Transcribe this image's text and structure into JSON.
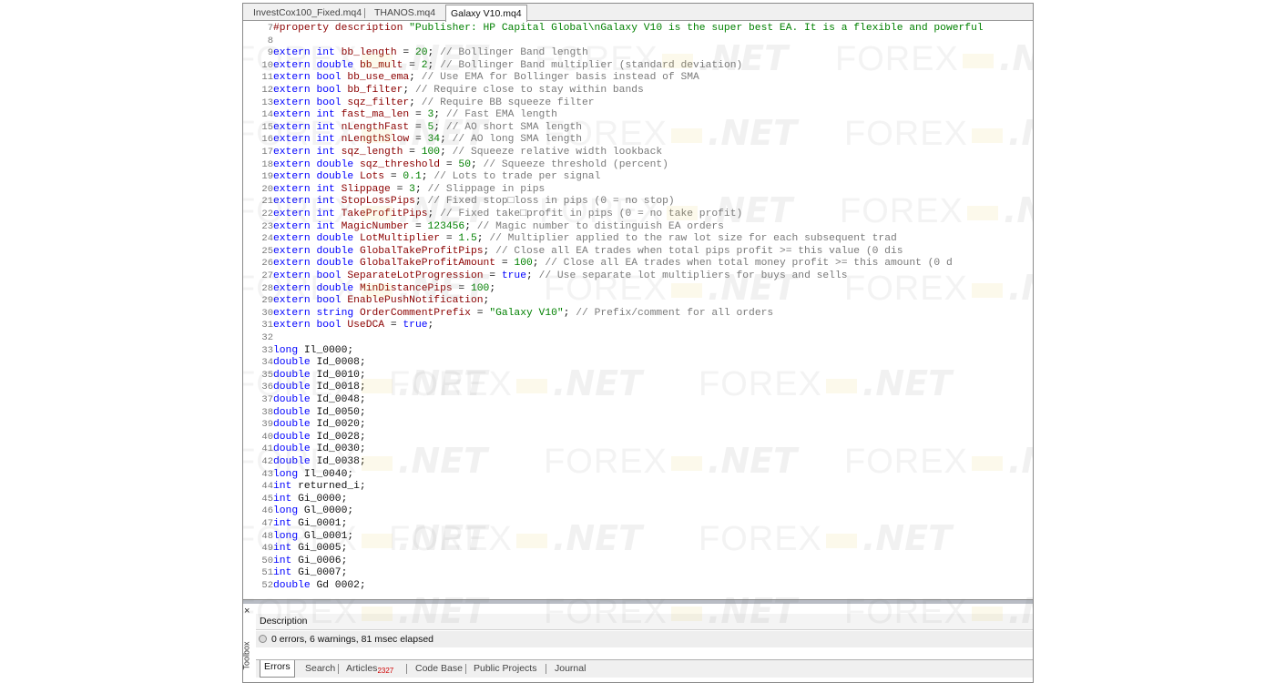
{
  "editor_tabs": [
    {
      "label": "InvestCox100_Fixed.mq4",
      "active": false
    },
    {
      "label": "THANOS.mq4",
      "active": false
    },
    {
      "label": "Galaxy V10.mq4",
      "active": true
    }
  ],
  "code_lines": [
    {
      "n": "7",
      "tokens": [
        [
          "pp",
          "#property"
        ],
        [
          "src",
          " "
        ],
        [
          "var",
          "description"
        ],
        [
          "src",
          " "
        ],
        [
          "str",
          "\"Publisher: HP Capital Global\\nGalaxy V10 is the super best EA. It is a flexible and powerful"
        ]
      ]
    },
    {
      "n": "8",
      "tokens": []
    },
    {
      "n": "9",
      "tokens": [
        [
          "kw",
          "extern"
        ],
        [
          "src",
          " "
        ],
        [
          "kw",
          "int"
        ],
        [
          "src",
          " "
        ],
        [
          "var",
          "bb_length"
        ],
        [
          "src",
          " = "
        ],
        [
          "num",
          "20"
        ],
        [
          "src",
          "; "
        ],
        [
          "cm",
          "// Bollinger Band length"
        ]
      ]
    },
    {
      "n": "10",
      "tokens": [
        [
          "kw",
          "extern"
        ],
        [
          "src",
          " "
        ],
        [
          "kw",
          "double"
        ],
        [
          "src",
          " "
        ],
        [
          "var",
          "bb_mult"
        ],
        [
          "src",
          " = "
        ],
        [
          "num",
          "2"
        ],
        [
          "src",
          "; "
        ],
        [
          "cm",
          "// Bollinger Band multiplier (standard deviation)"
        ]
      ]
    },
    {
      "n": "11",
      "tokens": [
        [
          "kw",
          "extern"
        ],
        [
          "src",
          " "
        ],
        [
          "kw",
          "bool"
        ],
        [
          "src",
          " "
        ],
        [
          "var",
          "bb_use_ema"
        ],
        [
          "src",
          "; "
        ],
        [
          "cm",
          "// Use EMA for Bollinger basis instead of SMA"
        ]
      ]
    },
    {
      "n": "12",
      "tokens": [
        [
          "kw",
          "extern"
        ],
        [
          "src",
          " "
        ],
        [
          "kw",
          "bool"
        ],
        [
          "src",
          " "
        ],
        [
          "var",
          "bb_filter"
        ],
        [
          "src",
          "; "
        ],
        [
          "cm",
          "// Require close to stay within bands"
        ]
      ]
    },
    {
      "n": "13",
      "tokens": [
        [
          "kw",
          "extern"
        ],
        [
          "src",
          " "
        ],
        [
          "kw",
          "bool"
        ],
        [
          "src",
          " "
        ],
        [
          "var",
          "sqz_filter"
        ],
        [
          "src",
          "; "
        ],
        [
          "cm",
          "// Require BB squeeze filter"
        ]
      ]
    },
    {
      "n": "14",
      "tokens": [
        [
          "kw",
          "extern"
        ],
        [
          "src",
          " "
        ],
        [
          "kw",
          "int"
        ],
        [
          "src",
          " "
        ],
        [
          "var",
          "fast_ma_len"
        ],
        [
          "src",
          " = "
        ],
        [
          "num",
          "3"
        ],
        [
          "src",
          "; "
        ],
        [
          "cm",
          "// Fast EMA length"
        ]
      ]
    },
    {
      "n": "15",
      "tokens": [
        [
          "kw",
          "extern"
        ],
        [
          "src",
          " "
        ],
        [
          "kw",
          "int"
        ],
        [
          "src",
          " "
        ],
        [
          "var",
          "nLengthFast"
        ],
        [
          "src",
          " = "
        ],
        [
          "num",
          "5"
        ],
        [
          "src",
          "; "
        ],
        [
          "cm",
          "// AO short SMA length"
        ]
      ]
    },
    {
      "n": "16",
      "tokens": [
        [
          "kw",
          "extern"
        ],
        [
          "src",
          " "
        ],
        [
          "kw",
          "int"
        ],
        [
          "src",
          " "
        ],
        [
          "var",
          "nLengthSlow"
        ],
        [
          "src",
          " = "
        ],
        [
          "num",
          "34"
        ],
        [
          "src",
          "; "
        ],
        [
          "cm",
          "// AO long SMA length"
        ]
      ]
    },
    {
      "n": "17",
      "tokens": [
        [
          "kw",
          "extern"
        ],
        [
          "src",
          " "
        ],
        [
          "kw",
          "int"
        ],
        [
          "src",
          " "
        ],
        [
          "var",
          "sqz_length"
        ],
        [
          "src",
          " = "
        ],
        [
          "num",
          "100"
        ],
        [
          "src",
          "; "
        ],
        [
          "cm",
          "// Squeeze relative width lookback"
        ]
      ]
    },
    {
      "n": "18",
      "tokens": [
        [
          "kw",
          "extern"
        ],
        [
          "src",
          " "
        ],
        [
          "kw",
          "double"
        ],
        [
          "src",
          " "
        ],
        [
          "var",
          "sqz_threshold"
        ],
        [
          "src",
          " = "
        ],
        [
          "num",
          "50"
        ],
        [
          "src",
          "; "
        ],
        [
          "cm",
          "// Squeeze threshold (percent)"
        ]
      ]
    },
    {
      "n": "19",
      "tokens": [
        [
          "kw",
          "extern"
        ],
        [
          "src",
          " "
        ],
        [
          "kw",
          "double"
        ],
        [
          "src",
          " "
        ],
        [
          "var",
          "Lots"
        ],
        [
          "src",
          " = "
        ],
        [
          "num",
          "0.1"
        ],
        [
          "src",
          "; "
        ],
        [
          "cm",
          "// Lots to trade per signal"
        ]
      ]
    },
    {
      "n": "20",
      "tokens": [
        [
          "kw",
          "extern"
        ],
        [
          "src",
          " "
        ],
        [
          "kw",
          "int"
        ],
        [
          "src",
          " "
        ],
        [
          "var",
          "Slippage"
        ],
        [
          "src",
          " = "
        ],
        [
          "num",
          "3"
        ],
        [
          "src",
          "; "
        ],
        [
          "cm",
          "// Slippage in pips"
        ]
      ]
    },
    {
      "n": "21",
      "tokens": [
        [
          "kw",
          "extern"
        ],
        [
          "src",
          " "
        ],
        [
          "kw",
          "int"
        ],
        [
          "src",
          " "
        ],
        [
          "var",
          "StopLossPips"
        ],
        [
          "src",
          "; "
        ],
        [
          "cm",
          "// Fixed stop□loss in pips (0 = no stop)"
        ]
      ]
    },
    {
      "n": "22",
      "tokens": [
        [
          "kw",
          "extern"
        ],
        [
          "src",
          " "
        ],
        [
          "kw",
          "int"
        ],
        [
          "src",
          " "
        ],
        [
          "var",
          "TakeProfitPips"
        ],
        [
          "src",
          "; "
        ],
        [
          "cm",
          "// Fixed take□profit in pips (0 = no take profit)"
        ]
      ]
    },
    {
      "n": "23",
      "tokens": [
        [
          "kw",
          "extern"
        ],
        [
          "src",
          " "
        ],
        [
          "kw",
          "int"
        ],
        [
          "src",
          " "
        ],
        [
          "var",
          "MagicNumber"
        ],
        [
          "src",
          " = "
        ],
        [
          "num",
          "123456"
        ],
        [
          "src",
          "; "
        ],
        [
          "cm",
          "// Magic number to distinguish EA orders"
        ]
      ]
    },
    {
      "n": "24",
      "tokens": [
        [
          "kw",
          "extern"
        ],
        [
          "src",
          " "
        ],
        [
          "kw",
          "double"
        ],
        [
          "src",
          " "
        ],
        [
          "var",
          "LotMultiplier"
        ],
        [
          "src",
          " = "
        ],
        [
          "num",
          "1.5"
        ],
        [
          "src",
          "; "
        ],
        [
          "cm",
          "// Multiplier applied to the raw lot size for each subsequent trad"
        ]
      ]
    },
    {
      "n": "25",
      "tokens": [
        [
          "kw",
          "extern"
        ],
        [
          "src",
          " "
        ],
        [
          "kw",
          "double"
        ],
        [
          "src",
          " "
        ],
        [
          "var",
          "GlobalTakeProfitPips"
        ],
        [
          "src",
          "; "
        ],
        [
          "cm",
          "// Close all EA trades when total pips profit >= this value (0 dis"
        ]
      ]
    },
    {
      "n": "26",
      "tokens": [
        [
          "kw",
          "extern"
        ],
        [
          "src",
          " "
        ],
        [
          "kw",
          "double"
        ],
        [
          "src",
          " "
        ],
        [
          "var",
          "GlobalTakeProfitAmount"
        ],
        [
          "src",
          " = "
        ],
        [
          "num",
          "100"
        ],
        [
          "src",
          "; "
        ],
        [
          "cm",
          "// Close all EA trades when total money profit >= this amount (0 d"
        ]
      ]
    },
    {
      "n": "27",
      "tokens": [
        [
          "kw",
          "extern"
        ],
        [
          "src",
          " "
        ],
        [
          "kw",
          "bool"
        ],
        [
          "src",
          " "
        ],
        [
          "var",
          "SeparateLotProgression"
        ],
        [
          "src",
          " = "
        ],
        [
          "kw",
          "true"
        ],
        [
          "src",
          "; "
        ],
        [
          "cm",
          "// Use separate lot multipliers for buys and sells"
        ]
      ]
    },
    {
      "n": "28",
      "tokens": [
        [
          "kw",
          "extern"
        ],
        [
          "src",
          " "
        ],
        [
          "kw",
          "double"
        ],
        [
          "src",
          " "
        ],
        [
          "var",
          "MinDistancePips"
        ],
        [
          "src",
          " = "
        ],
        [
          "num",
          "100"
        ],
        [
          "src",
          ";"
        ]
      ]
    },
    {
      "n": "29",
      "tokens": [
        [
          "kw",
          "extern"
        ],
        [
          "src",
          " "
        ],
        [
          "kw",
          "bool"
        ],
        [
          "src",
          " "
        ],
        [
          "var",
          "EnablePushNotification"
        ],
        [
          "src",
          ";"
        ]
      ]
    },
    {
      "n": "30",
      "tokens": [
        [
          "kw",
          "extern"
        ],
        [
          "src",
          " "
        ],
        [
          "kw",
          "string"
        ],
        [
          "src",
          " "
        ],
        [
          "var",
          "OrderCommentPrefix"
        ],
        [
          "src",
          " = "
        ],
        [
          "str",
          "\"Galaxy V10\""
        ],
        [
          "src",
          "; "
        ],
        [
          "cm",
          "// Prefix/comment for all orders"
        ]
      ]
    },
    {
      "n": "31",
      "tokens": [
        [
          "kw",
          "extern"
        ],
        [
          "src",
          " "
        ],
        [
          "kw",
          "bool"
        ],
        [
          "src",
          " "
        ],
        [
          "var",
          "UseDCA"
        ],
        [
          "src",
          " = "
        ],
        [
          "kw",
          "true"
        ],
        [
          "src",
          ";"
        ]
      ]
    },
    {
      "n": "32",
      "tokens": []
    },
    {
      "n": "33",
      "tokens": [
        [
          "kw",
          "long"
        ],
        [
          "src",
          " Il_0000;"
        ]
      ]
    },
    {
      "n": "34",
      "tokens": [
        [
          "kw",
          "double"
        ],
        [
          "src",
          " Id_0008;"
        ]
      ]
    },
    {
      "n": "35",
      "tokens": [
        [
          "kw",
          "double"
        ],
        [
          "src",
          " Id_0010;"
        ]
      ]
    },
    {
      "n": "36",
      "tokens": [
        [
          "kw",
          "double"
        ],
        [
          "src",
          " Id_0018;"
        ]
      ]
    },
    {
      "n": "37",
      "tokens": [
        [
          "kw",
          "double"
        ],
        [
          "src",
          " Id_0048;"
        ]
      ]
    },
    {
      "n": "38",
      "tokens": [
        [
          "kw",
          "double"
        ],
        [
          "src",
          " Id_0050;"
        ]
      ]
    },
    {
      "n": "39",
      "tokens": [
        [
          "kw",
          "double"
        ],
        [
          "src",
          " Id_0020;"
        ]
      ]
    },
    {
      "n": "40",
      "tokens": [
        [
          "kw",
          "double"
        ],
        [
          "src",
          " Id_0028;"
        ]
      ]
    },
    {
      "n": "41",
      "tokens": [
        [
          "kw",
          "double"
        ],
        [
          "src",
          " Id_0030;"
        ]
      ]
    },
    {
      "n": "42",
      "tokens": [
        [
          "kw",
          "double"
        ],
        [
          "src",
          " Id_0038;"
        ]
      ]
    },
    {
      "n": "43",
      "tokens": [
        [
          "kw",
          "long"
        ],
        [
          "src",
          " Il_0040;"
        ]
      ]
    },
    {
      "n": "44",
      "tokens": [
        [
          "kw",
          "int"
        ],
        [
          "src",
          " returned_i;"
        ]
      ]
    },
    {
      "n": "45",
      "tokens": [
        [
          "kw",
          "int"
        ],
        [
          "src",
          " Gi_0000;"
        ]
      ]
    },
    {
      "n": "46",
      "tokens": [
        [
          "kw",
          "long"
        ],
        [
          "src",
          " Gl_0000;"
        ]
      ]
    },
    {
      "n": "47",
      "tokens": [
        [
          "kw",
          "int"
        ],
        [
          "src",
          " Gi_0001;"
        ]
      ]
    },
    {
      "n": "48",
      "tokens": [
        [
          "kw",
          "long"
        ],
        [
          "src",
          " Gl_0001;"
        ]
      ]
    },
    {
      "n": "49",
      "tokens": [
        [
          "kw",
          "int"
        ],
        [
          "src",
          " Gi_0005;"
        ]
      ]
    },
    {
      "n": "50",
      "tokens": [
        [
          "kw",
          "int"
        ],
        [
          "src",
          " Gi_0006;"
        ]
      ]
    },
    {
      "n": "51",
      "tokens": [
        [
          "kw",
          "int"
        ],
        [
          "src",
          " Gi_0007;"
        ]
      ]
    },
    {
      "n": "52",
      "tokens": [
        [
          "kw",
          "double"
        ],
        [
          "src",
          " Gd 0002;"
        ]
      ]
    }
  ],
  "toolbox": {
    "close_glyph": "×",
    "vertical_label": "Toolbox",
    "column_header": "Description",
    "message": "0 errors, 6 warnings, 81 msec elapsed"
  },
  "bottom_tabs": [
    {
      "label": "Errors",
      "active": true
    },
    {
      "label": "Search",
      "active": false
    },
    {
      "label": "Articles",
      "badge": "2327",
      "active": false
    },
    {
      "label": "Code Base",
      "active": false
    },
    {
      "label": "Public Projects",
      "active": false
    },
    {
      "label": "Journal",
      "active": false
    }
  ],
  "watermark": {
    "word": "FOREX",
    "suffix": ".NET"
  },
  "colors": {
    "keyword": "#0000ff",
    "identifier": "#8b0000",
    "number": "#008000",
    "comment": "#7a7a7a",
    "string": "#008000",
    "badge": "#d00000"
  }
}
